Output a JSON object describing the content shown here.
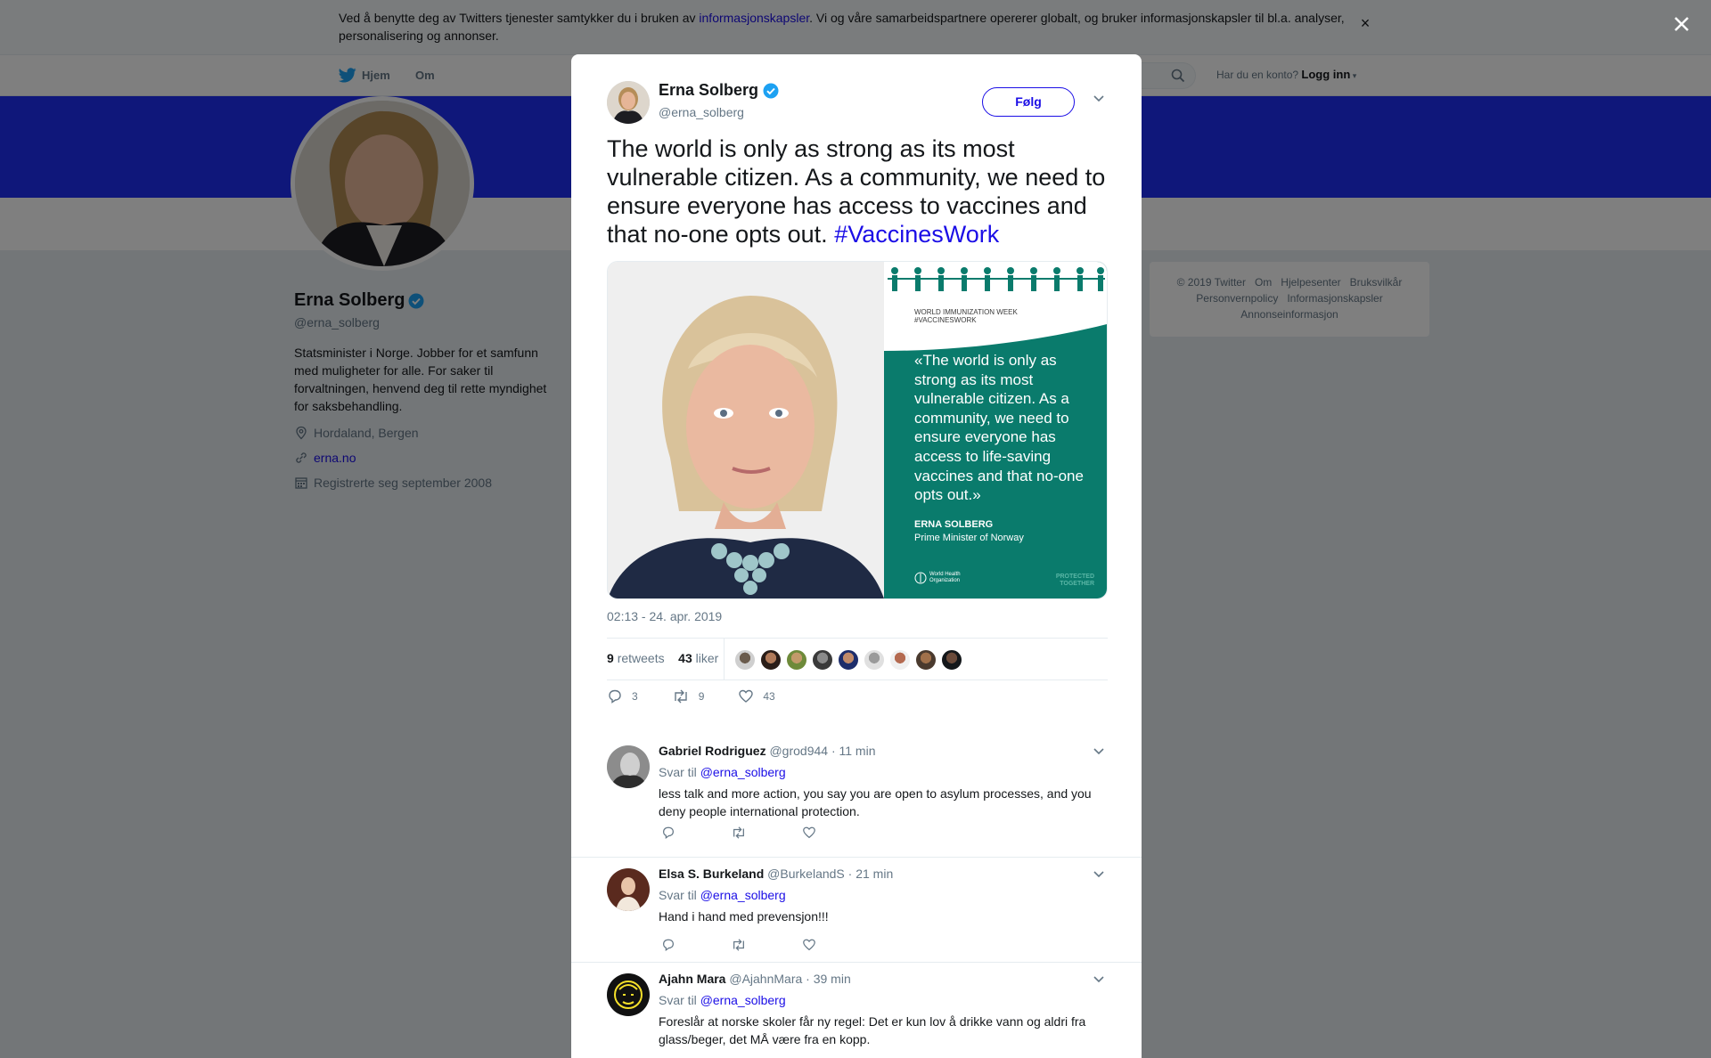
{
  "cookie": {
    "text_before": "Ved å benytte deg av Twitters tjenester samtykker du i bruken av ",
    "link": "informasjonskapsler",
    "text_after": ". Vi og våre samarbeidspartnere opererer globalt, og bruker informasjonskapsler til bl.a. analyser, personalisering og annonser.",
    "close": "×"
  },
  "nav": {
    "home": "Hjem",
    "about": "Om",
    "login_prompt": "Har du en konto?",
    "login": "Logg inn"
  },
  "profile": {
    "name": "Erna Solberg",
    "handle": "@erna_solberg",
    "bio": "Statsminister i Norge. Jobber for et samfunn med muligheter for alle. For saker til forvaltningen, henvend deg til rette myndighet for saksbehandling.",
    "location": "Hordaland, Bergen",
    "url": "erna.no",
    "joined": "Registrerte seg september 2008"
  },
  "footer": {
    "copyright": "© 2019 Twitter",
    "about": "Om",
    "help": "Hjelpesenter",
    "terms": "Bruksvilkår",
    "privacy": "Personvernpolicy",
    "cookies": "Informasjonskapsler",
    "ads": "Annonseinformasjon"
  },
  "tweet": {
    "name": "Erna Solberg",
    "handle": "@erna_solberg",
    "follow": "Følg",
    "text": "The world is only as strong as its most vulnerable citizen. As a community, we need to ensure everyone has access to vaccines and that no-one opts out. ",
    "hashtag": "#VaccinesWork",
    "image": {
      "week": "WORLD IMMUNIZATION WEEK",
      "week_tag": "#VACCINESWORK",
      "quote": "«The world is only as strong as its most vulnerable citizen. As a community, we need to ensure everyone has access to life-saving vaccines and that no-one opts out.»",
      "author": "ERNA SOLBERG",
      "author_title": "Prime Minister of Norway",
      "who": "World Health Organization",
      "protected": "PROTECTED TOGETHER"
    },
    "time": "02:13 - 24. apr. 2019",
    "retweets_count": "9",
    "retweets_label": "retweets",
    "likes_count": "43",
    "likes_label": "liker",
    "replies": "3",
    "retweets": "9",
    "likes": "43"
  },
  "replies": [
    {
      "name": "Gabriel Rodriguez",
      "handle": "@grod944",
      "time": "· 11 min",
      "to_label": "Svar til",
      "to": "@erna_solberg",
      "text": "less talk and more action, you say you are open to asylum processes, and you deny people international protection."
    },
    {
      "name": "Elsa S. Burkeland",
      "handle": "@BurkelandS",
      "time": "· 21 min",
      "to_label": "Svar til",
      "to": "@erna_solberg",
      "text": "Hand i hand med prevensjon!!!"
    },
    {
      "name": "Ajahn Mara",
      "handle": "@AjahnMara",
      "time": "· 39 min",
      "to_label": "Svar til",
      "to": "@erna_solberg",
      "text": "Foreslår at norske skoler får ny regel: Det er kun lov å drikke vann og aldri fra glass/beger, det MÅ være fra en kopp."
    }
  ],
  "colors": {
    "link": "#1b0ee6",
    "banner": "#1e2ef5",
    "who_green": "#0a7b6c",
    "muted": "#657786"
  }
}
